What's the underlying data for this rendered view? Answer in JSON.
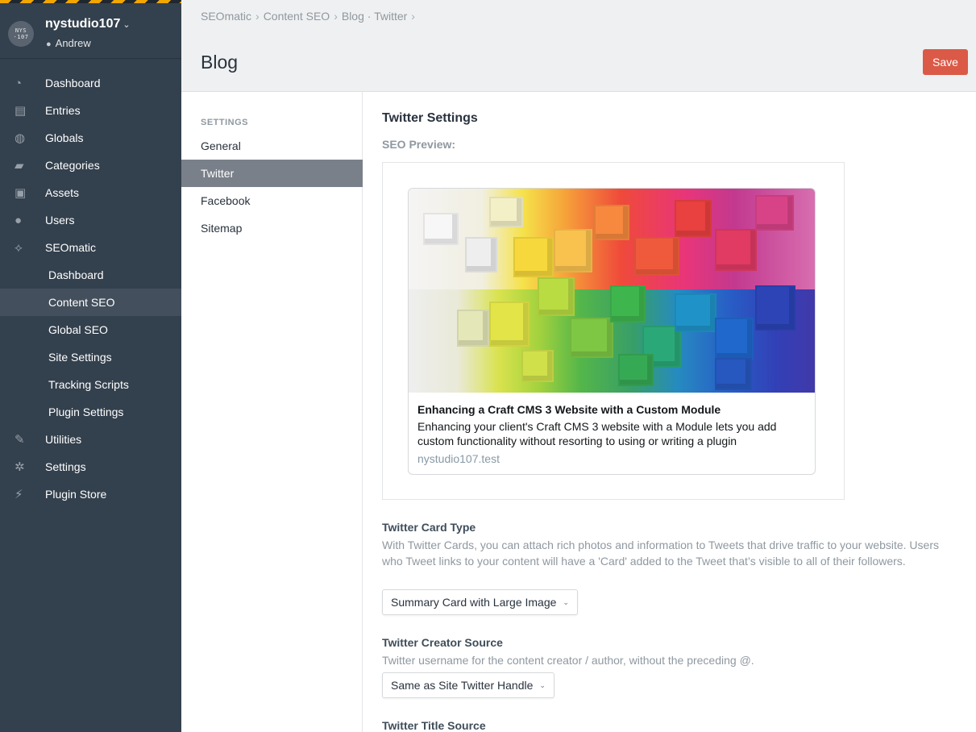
{
  "site": {
    "logo_text": "NYS\n107",
    "name": "nystudio107",
    "user": "Andrew"
  },
  "nav": {
    "items": [
      {
        "label": "Dashboard",
        "icon": "dashboard-icon"
      },
      {
        "label": "Entries",
        "icon": "entries-icon"
      },
      {
        "label": "Globals",
        "icon": "globe-icon"
      },
      {
        "label": "Categories",
        "icon": "folder-icon"
      },
      {
        "label": "Assets",
        "icon": "image-icon"
      },
      {
        "label": "Users",
        "icon": "users-icon"
      },
      {
        "label": "SEOmatic",
        "icon": "seomatic-icon"
      }
    ],
    "sub_items": [
      {
        "label": "Dashboard"
      },
      {
        "label": "Content SEO",
        "active": true
      },
      {
        "label": "Global SEO"
      },
      {
        "label": "Site Settings"
      },
      {
        "label": "Tracking Scripts"
      },
      {
        "label": "Plugin Settings"
      }
    ],
    "bottom_items": [
      {
        "label": "Utilities",
        "icon": "wrench-icon"
      },
      {
        "label": "Settings",
        "icon": "gear-icon"
      },
      {
        "label": "Plugin Store",
        "icon": "plug-icon"
      }
    ]
  },
  "breadcrumb": [
    "SEOmatic",
    "Content SEO",
    "Blog · Twitter"
  ],
  "page": {
    "title": "Blog",
    "save_label": "Save"
  },
  "settings_nav": {
    "heading": "SETTINGS",
    "items": [
      {
        "label": "General"
      },
      {
        "label": "Twitter",
        "active": true
      },
      {
        "label": "Facebook"
      },
      {
        "label": "Sitemap"
      }
    ]
  },
  "main": {
    "title": "Twitter Settings",
    "preview_label": "SEO Preview:",
    "card": {
      "title": "Enhancing a Craft CMS 3 Website with a Custom Module",
      "description": "Enhancing your client's Craft CMS 3 website with a Module lets you add custom functionality without resorting to using or writing a plugin",
      "domain": "nystudio107.test"
    },
    "fields": [
      {
        "label": "Twitter Card Type",
        "instructions": "With Twitter Cards, you can attach rich photos and information to Tweets that drive traffic to your website. Users who Tweet links to your content will have a 'Card' added to the Tweet that’s visible to all of their followers.",
        "value": "Summary Card with Large Image"
      },
      {
        "label": "Twitter Creator Source",
        "instructions": "Twitter username for the content creator / author, without the preceding @.",
        "value": "Same as Site Twitter Handle"
      },
      {
        "label": "Twitter Title Source"
      }
    ]
  },
  "colors": {
    "sidebar_bg": "#33404d",
    "save_button": "#da5a47",
    "active_setting": "#798089"
  }
}
